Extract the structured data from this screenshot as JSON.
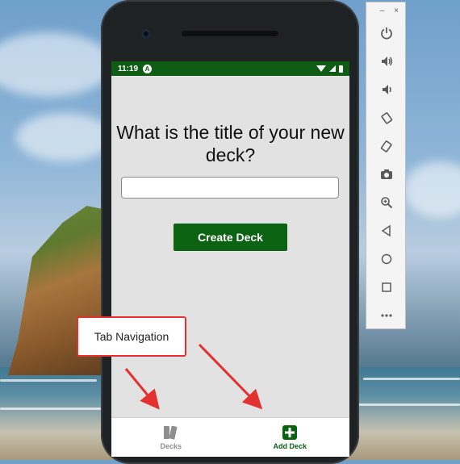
{
  "status_bar": {
    "time": "11:19",
    "indicator": "A"
  },
  "screen": {
    "question": "What is the title of your new deck?",
    "title_input": {
      "value": "",
      "placeholder": ""
    },
    "create_button_label": "Create Deck"
  },
  "tabs": [
    {
      "label": "Decks",
      "icon": "deck-cards-icon",
      "active": false
    },
    {
      "label": "Add Deck",
      "icon": "plus-square-icon",
      "active": true
    }
  ],
  "emulator_toolbar": {
    "window_controls": [
      "–",
      "×"
    ],
    "buttons": [
      "power-icon",
      "volume-up-icon",
      "volume-down-icon",
      "rotate-left-icon",
      "rotate-right-icon",
      "camera-icon",
      "zoom-icon",
      "back-icon",
      "home-icon",
      "overview-icon",
      "more-icon"
    ]
  },
  "callout": {
    "label": "Tab Navigation"
  },
  "colors": {
    "accent": "#0b6312",
    "status_bar": "#0f5d14",
    "callout_border": "#e4302f",
    "inactive_tab": "#8e8e8e"
  }
}
